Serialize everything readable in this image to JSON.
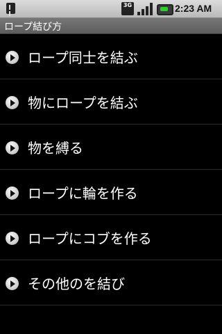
{
  "status": {
    "network": "3G",
    "time": "2:23 AM"
  },
  "app": {
    "title": "ロープ結び方"
  },
  "menu": {
    "items": [
      {
        "label": "ロープ同士を結ぶ"
      },
      {
        "label": "物にロープを結ぶ"
      },
      {
        "label": "物を縛る"
      },
      {
        "label": "ロープに輪を作る"
      },
      {
        "label": "ロープにコブを作る"
      },
      {
        "label": "その他のを結び"
      }
    ]
  }
}
